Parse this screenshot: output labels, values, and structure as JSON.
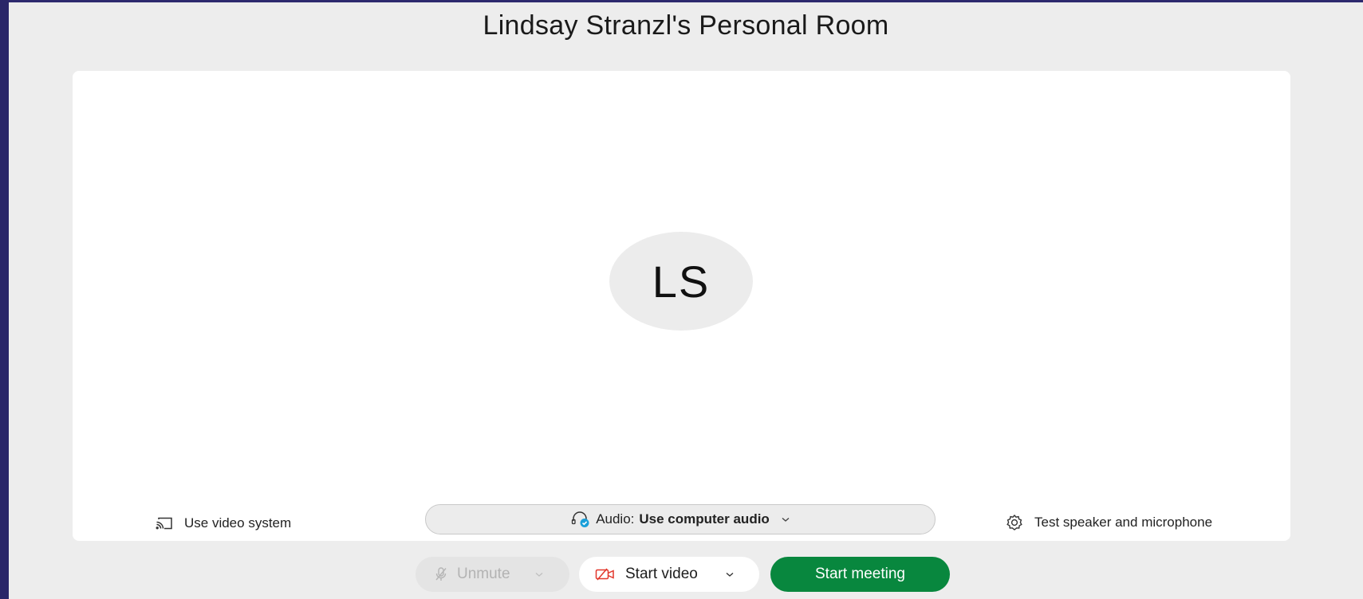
{
  "room": {
    "title": "Lindsay Stranzl's Personal Room"
  },
  "preview": {
    "avatar_initials": "LS"
  },
  "options": {
    "video_system_label": "Use video system",
    "audio_prefix": "Audio:",
    "audio_value": "Use computer audio",
    "test_label": "Test speaker and microphone"
  },
  "controls": {
    "unmute_label": "Unmute",
    "start_video_label": "Start video",
    "start_meeting_label": "Start meeting"
  },
  "colors": {
    "start_meeting_bg": "#08873e",
    "video_icon": "#e2372b",
    "audio_check": "#1a9fd9",
    "page_bg": "#ededed",
    "frame": "#2d2a6e"
  },
  "icons": {
    "video_system": "cast-icon",
    "audio": "headset-check-icon",
    "test": "gear-icon",
    "mute": "microphone-muted-icon",
    "video": "video-off-icon"
  }
}
